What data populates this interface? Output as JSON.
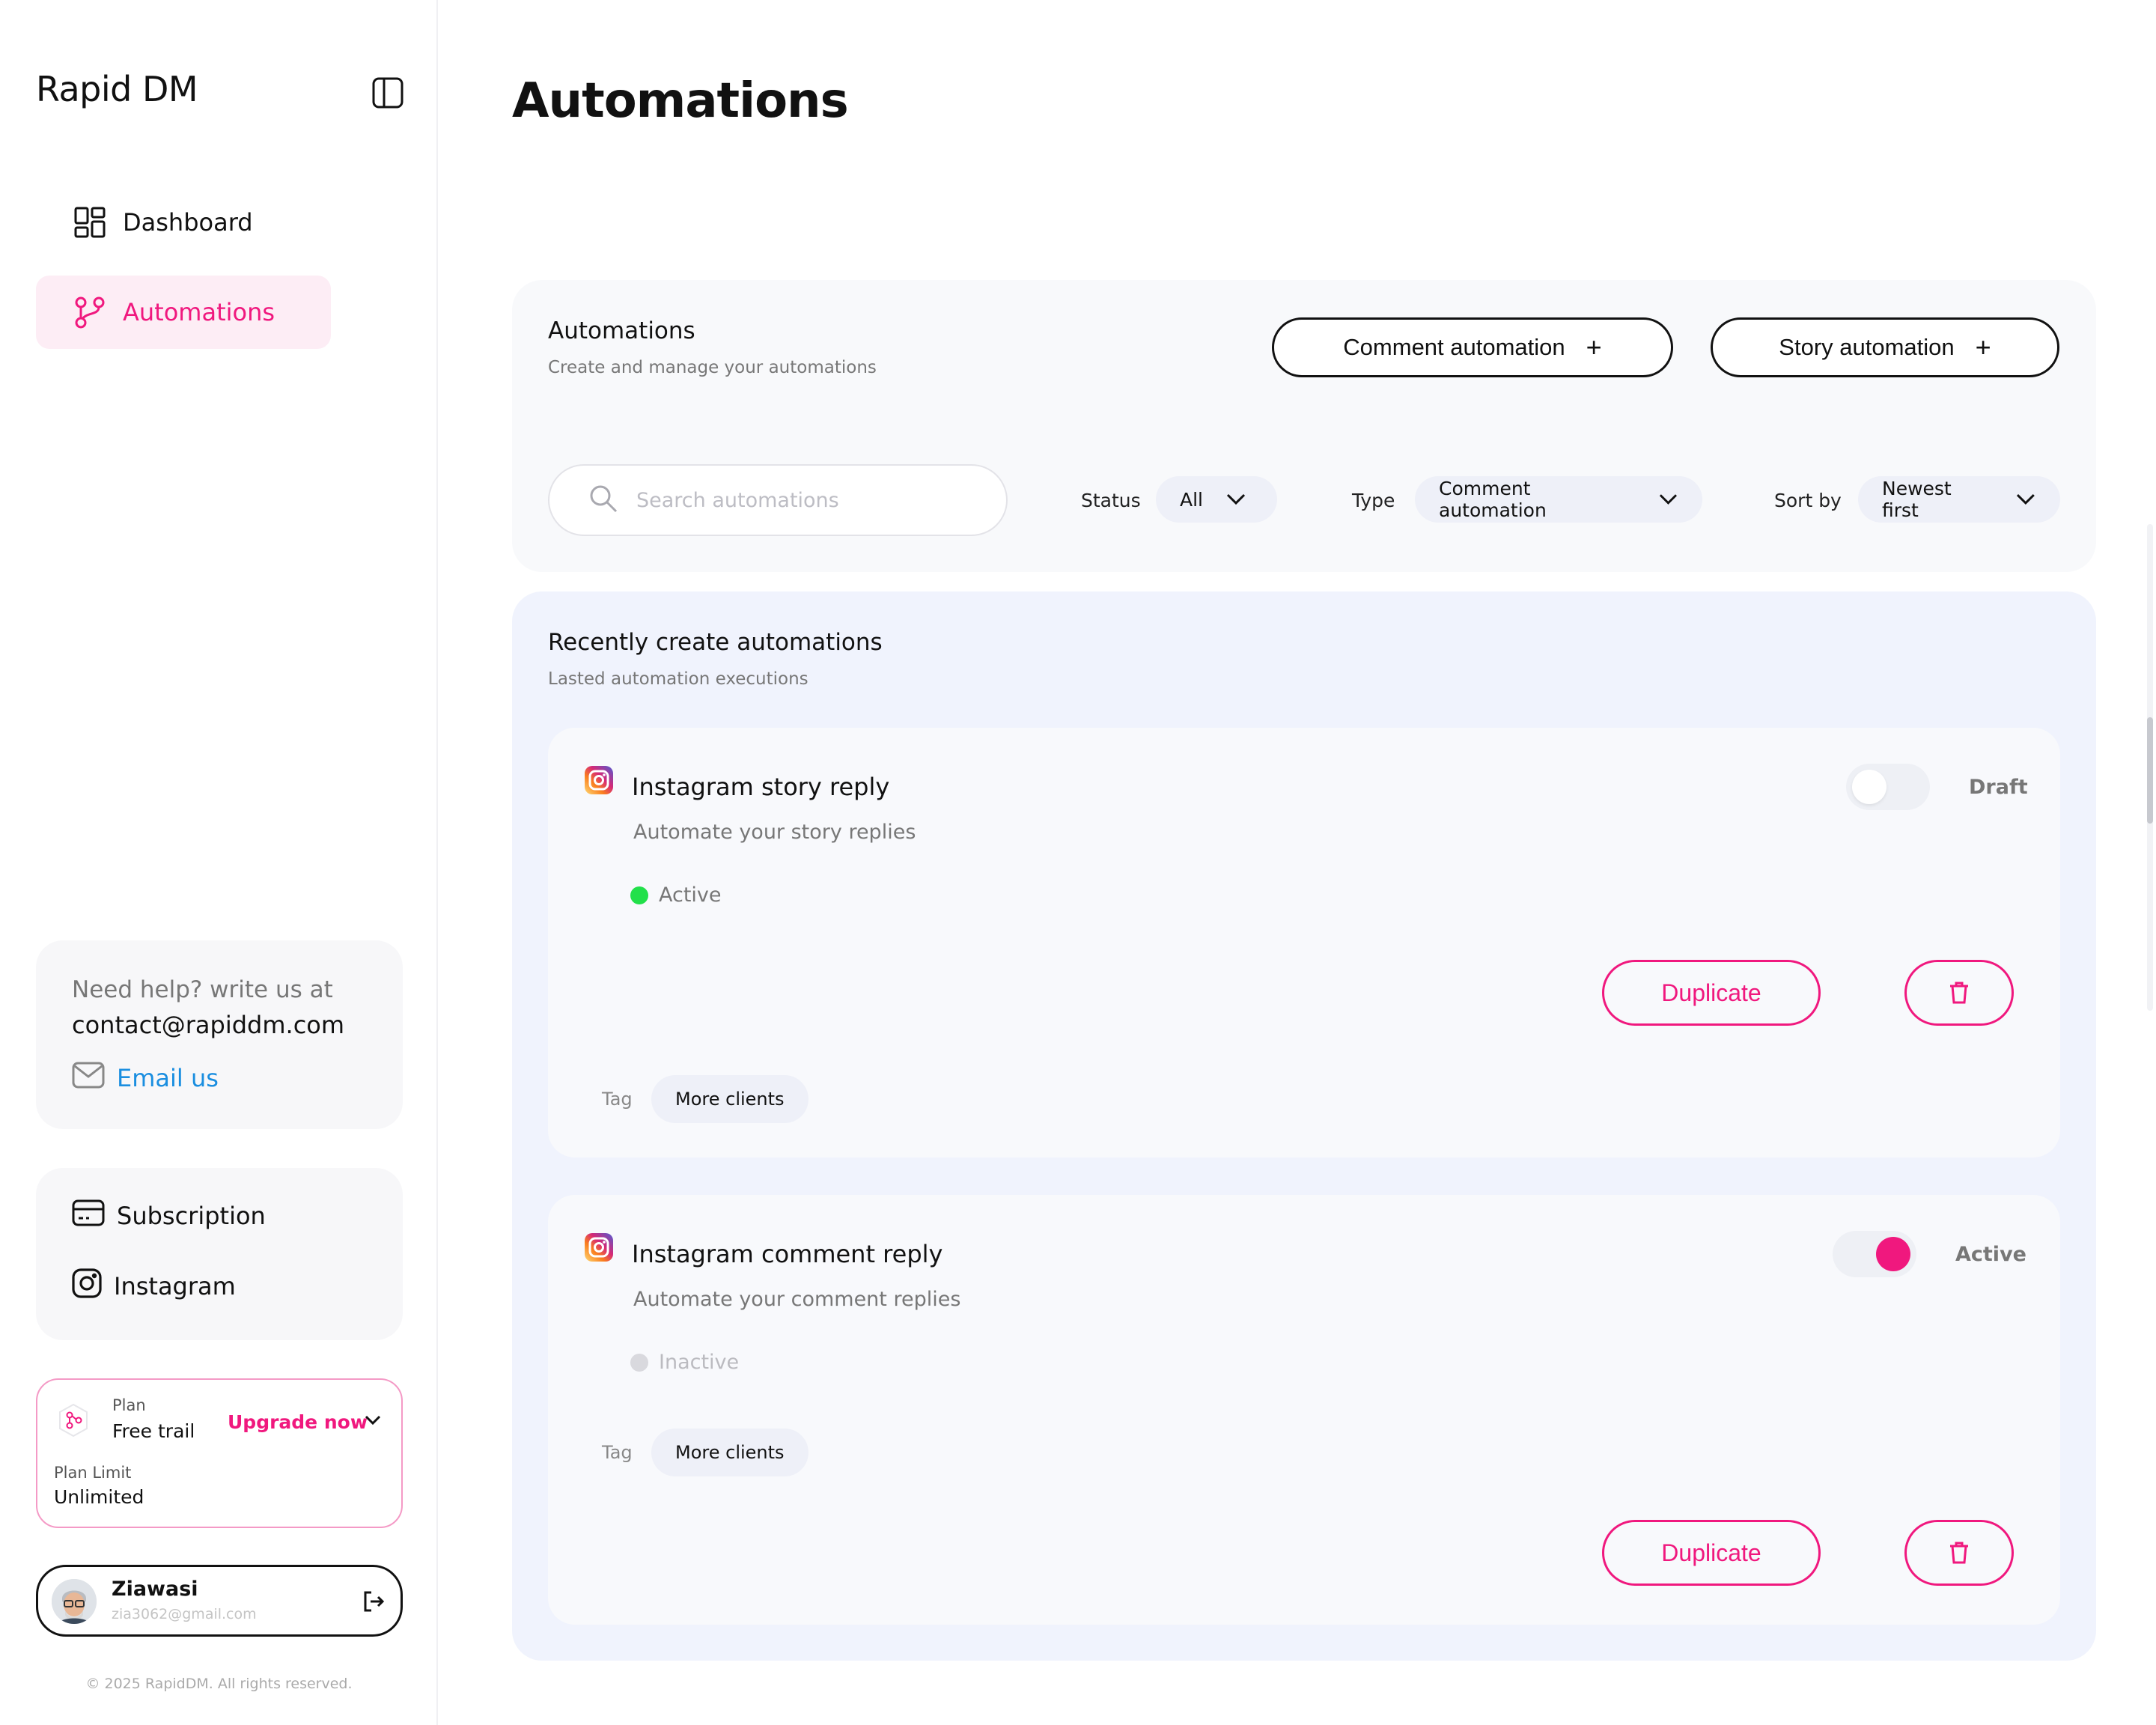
{
  "sidebar": {
    "brand": "Rapid DM",
    "nav": [
      {
        "label": "Dashboard",
        "icon": "dashboard-icon",
        "active": false
      },
      {
        "label": "Automations",
        "icon": "automation-flow-icon",
        "active": true
      }
    ],
    "help": {
      "line1": "Need help? write us at",
      "line2": "contact@rapiddm.com",
      "email_link": "Email us",
      "link_color": "#1a8ee0"
    },
    "links": [
      {
        "label": "Subscription",
        "icon": "credit-card-icon"
      },
      {
        "label": "Instagram",
        "icon": "instagram-icon"
      }
    ],
    "plan": {
      "plan_label": "Plan",
      "plan_value": "Free trail",
      "upgrade": "Upgrade now",
      "limit_label": "Plan Limit",
      "limit_value": "Unlimited"
    },
    "user": {
      "name": "Ziawasi",
      "email": "zia3062@gmail.com"
    },
    "copyright": "© 2025 RapidDM. All rights reserved."
  },
  "main": {
    "page_title": "Automations",
    "header": {
      "title": "Automations",
      "subtitle": "Create and manage your automations",
      "comment_btn": "Comment automation",
      "story_btn": "Story automation",
      "plus": "+",
      "search_placeholder": "Search automations",
      "filters": {
        "status_label": "Status",
        "status_value": "All",
        "type_label": "Type",
        "type_value": "Comment automation",
        "sort_label": "Sort by",
        "sort_value": "Newest first"
      }
    },
    "list": {
      "title": "Recently create automations",
      "subtitle": "Lasted automation executions",
      "items": [
        {
          "title": "Instagram story reply",
          "subtitle": "Automate your story replies",
          "status": "Active",
          "status_color": "#22e04a",
          "toggle_on": false,
          "toggle_label": "Draft",
          "duplicate": "Duplicate",
          "tag_label": "Tag",
          "tag": "More clients"
        },
        {
          "title": "Instagram comment reply",
          "subtitle": "Automate your comment replies",
          "status": "Inactive",
          "status_color": "#d9d9de",
          "toggle_on": true,
          "toggle_label": "Active",
          "duplicate": "Duplicate",
          "tag_label": "Tag",
          "tag": "More clients"
        }
      ]
    }
  },
  "colors": {
    "accent": "#f0187e",
    "active_nav_bg": "#fdedf5",
    "list_bg": "#f0f3fd"
  }
}
